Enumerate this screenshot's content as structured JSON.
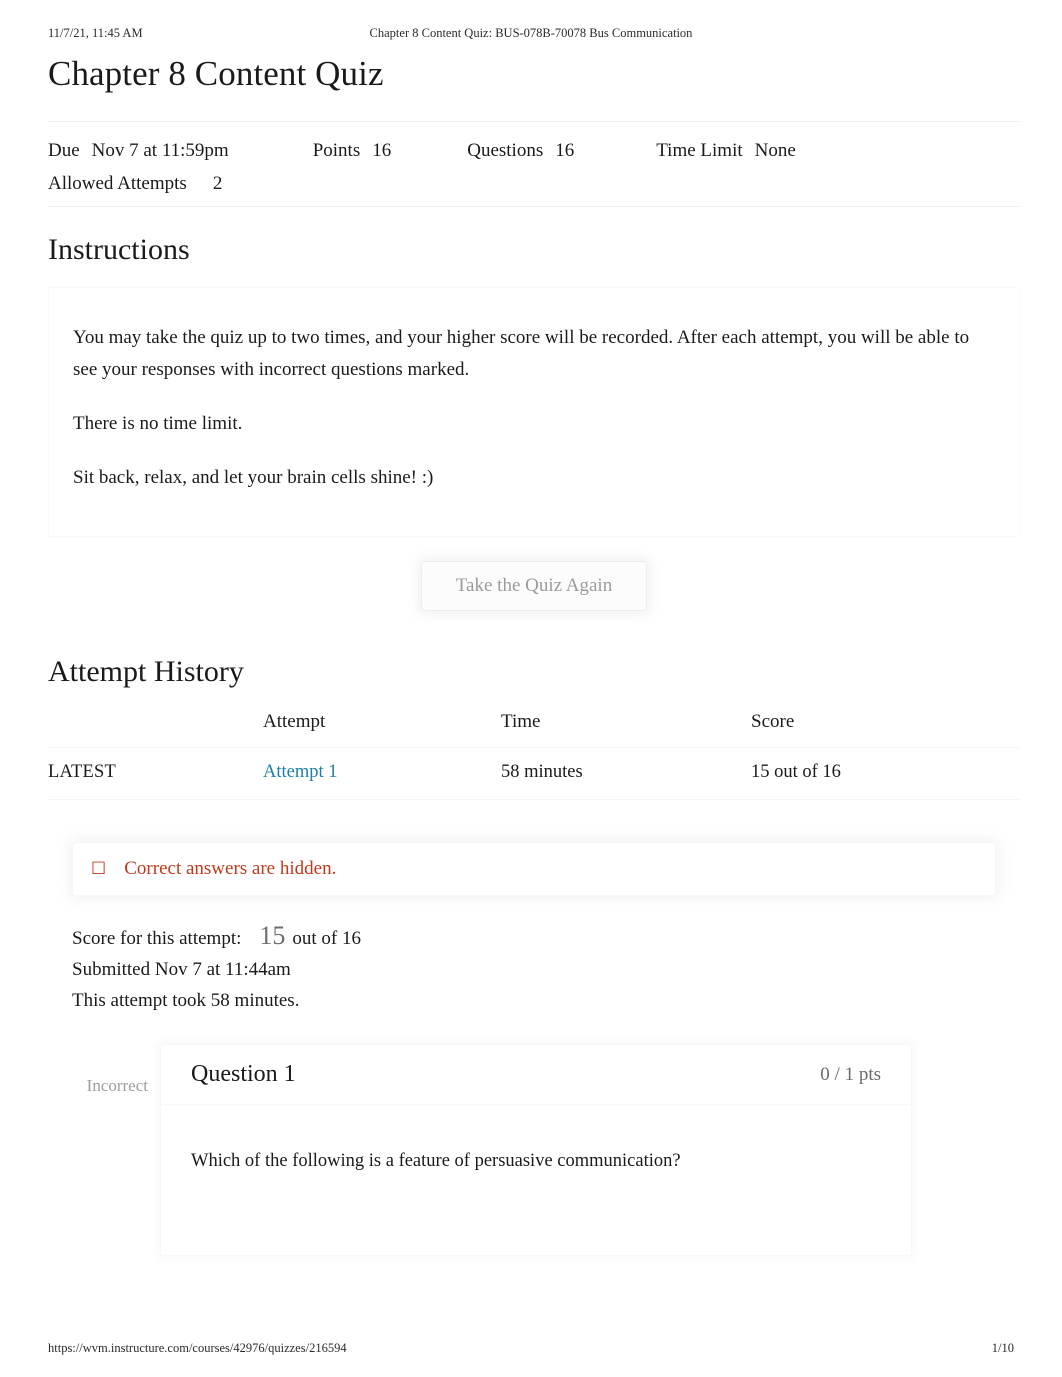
{
  "print_header": {
    "timestamp": "11/7/21, 11:45 AM",
    "document_title": "Chapter 8 Content Quiz: BUS-078B-70078 Bus Communication"
  },
  "quiz": {
    "title": "Chapter 8 Content Quiz",
    "meta": {
      "due_label": "Due",
      "due_value": "Nov 7 at 11:59pm",
      "points_label": "Points",
      "points_value": "16",
      "questions_label": "Questions",
      "questions_value": "16",
      "time_limit_label": "Time Limit",
      "time_limit_value": "None",
      "allowed_attempts_label": "Allowed Attempts",
      "allowed_attempts_value": "2"
    }
  },
  "instructions": {
    "heading": "Instructions",
    "paragraphs": [
      "You may take the quiz up to two times, and your higher score will be recorded. After each attempt, you will be able to see your responses with incorrect questions marked.",
      "There is no time limit.",
      "Sit back, relax, and let your brain cells shine! :)"
    ]
  },
  "actions": {
    "take_quiz_again_label": "Take the Quiz Again"
  },
  "attempt_history": {
    "heading": "Attempt History",
    "columns": [
      "",
      "Attempt",
      "Time",
      "Score"
    ],
    "rows": [
      {
        "kept": "LATEST",
        "attempt": "Attempt 1",
        "time": "58 minutes",
        "score": "15 out of 16"
      }
    ]
  },
  "alert": {
    "icon": "warning-icon",
    "glyph": "☐",
    "message": "Correct answers are hidden.",
    "color": "#c0391b"
  },
  "attempt_summary": {
    "score_label": "Score for this attempt:",
    "score_value": "15",
    "score_suffix": "out of 16",
    "submitted": "Submitted Nov 7 at 11:44am",
    "duration": "This attempt took 58 minutes."
  },
  "question": {
    "status": "Incorrect",
    "name": "Question 1",
    "points": "0 / 1 pts",
    "text": "Which of the following is a feature of persuasive communication?"
  },
  "print_footer": {
    "url": "https://wvm.instructure.com/courses/42976/quizzes/216594",
    "page": "1/10"
  },
  "colors": {
    "link": "#1b7fa8",
    "alert": "#c0391b",
    "muted": "#9e9e9e",
    "text": "#1a1a1a"
  }
}
